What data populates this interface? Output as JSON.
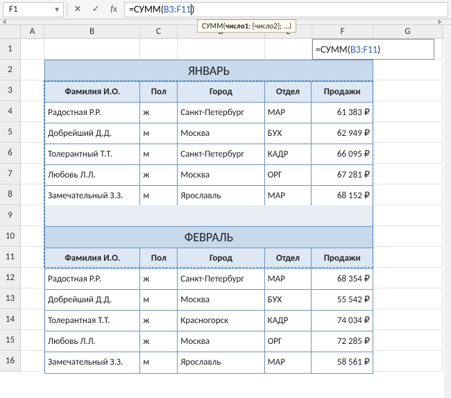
{
  "namebox": {
    "value": "F1"
  },
  "formula": {
    "eq": "=",
    "fn": "СУММ",
    "lp": "(",
    "ref": "B3:F11",
    "rp": ")"
  },
  "tooltip": {
    "fn": "СУММ",
    "lp": "(",
    "arg1": "число1",
    "rest": "; [число2]; ...)",
    "sep": ""
  },
  "fx_label": "fx",
  "columns": [
    "A",
    "B",
    "C",
    "D",
    "E",
    "F",
    "G"
  ],
  "row_numbers": [
    "1",
    "2",
    "3",
    "4",
    "5",
    "6",
    "7",
    "8",
    "9",
    "10",
    "11",
    "12",
    "13",
    "14",
    "15",
    "16"
  ],
  "table1": {
    "title": "ЯНВАРЬ",
    "headers": {
      "name": "Фамилия И.О.",
      "sex": "Пол",
      "city": "Город",
      "dept": "Отдел",
      "sales": "Продажи"
    },
    "rows": [
      {
        "name": "Радостная Р.Р.",
        "sex": "ж",
        "city": "Санкт-Петербург",
        "dept": "МАР",
        "sales": "61 383 ₽"
      },
      {
        "name": "Добрейший Д.Д.",
        "sex": "м",
        "city": "Москва",
        "dept": "БУХ",
        "sales": "62 949 ₽"
      },
      {
        "name": "Толерантный Т.Т.",
        "sex": "м",
        "city": "Санкт-Петербург",
        "dept": "КАДР",
        "sales": "66 095 ₽"
      },
      {
        "name": "Любовь Л.Л.",
        "sex": "ж",
        "city": "Москва",
        "dept": "ОРГ",
        "sales": "67 281 ₽"
      },
      {
        "name": "Замечательный З.З.",
        "sex": "м",
        "city": "Ярославль",
        "dept": "МАР",
        "sales": "68 152 ₽"
      }
    ]
  },
  "table2": {
    "title": "ФЕВРАЛЬ",
    "headers": {
      "name": "Фамилия И.О.",
      "sex": "Пол",
      "city": "Город",
      "dept": "Отдел",
      "sales": "Продажи"
    },
    "rows": [
      {
        "name": "Радостная Р.Р.",
        "sex": "ж",
        "city": "Санкт-Петербург",
        "dept": "МАР",
        "sales": "68 354 ₽"
      },
      {
        "name": "Добрейший Д.Д.",
        "sex": "м",
        "city": "Москва",
        "dept": "БУХ",
        "sales": "55 542 ₽"
      },
      {
        "name": "Толерантная Т.Т.",
        "sex": "ж",
        "city": "Красногорск",
        "dept": "КАДР",
        "sales": "74 034 ₽"
      },
      {
        "name": "Любовь Л.Л.",
        "sex": "ж",
        "city": "Москва",
        "dept": "ОРГ",
        "sales": "72 285 ₽"
      },
      {
        "name": "Замечательный З.З.",
        "sex": "м",
        "city": "Ярославль",
        "dept": "МАР",
        "sales": "58 561 ₽"
      }
    ]
  }
}
